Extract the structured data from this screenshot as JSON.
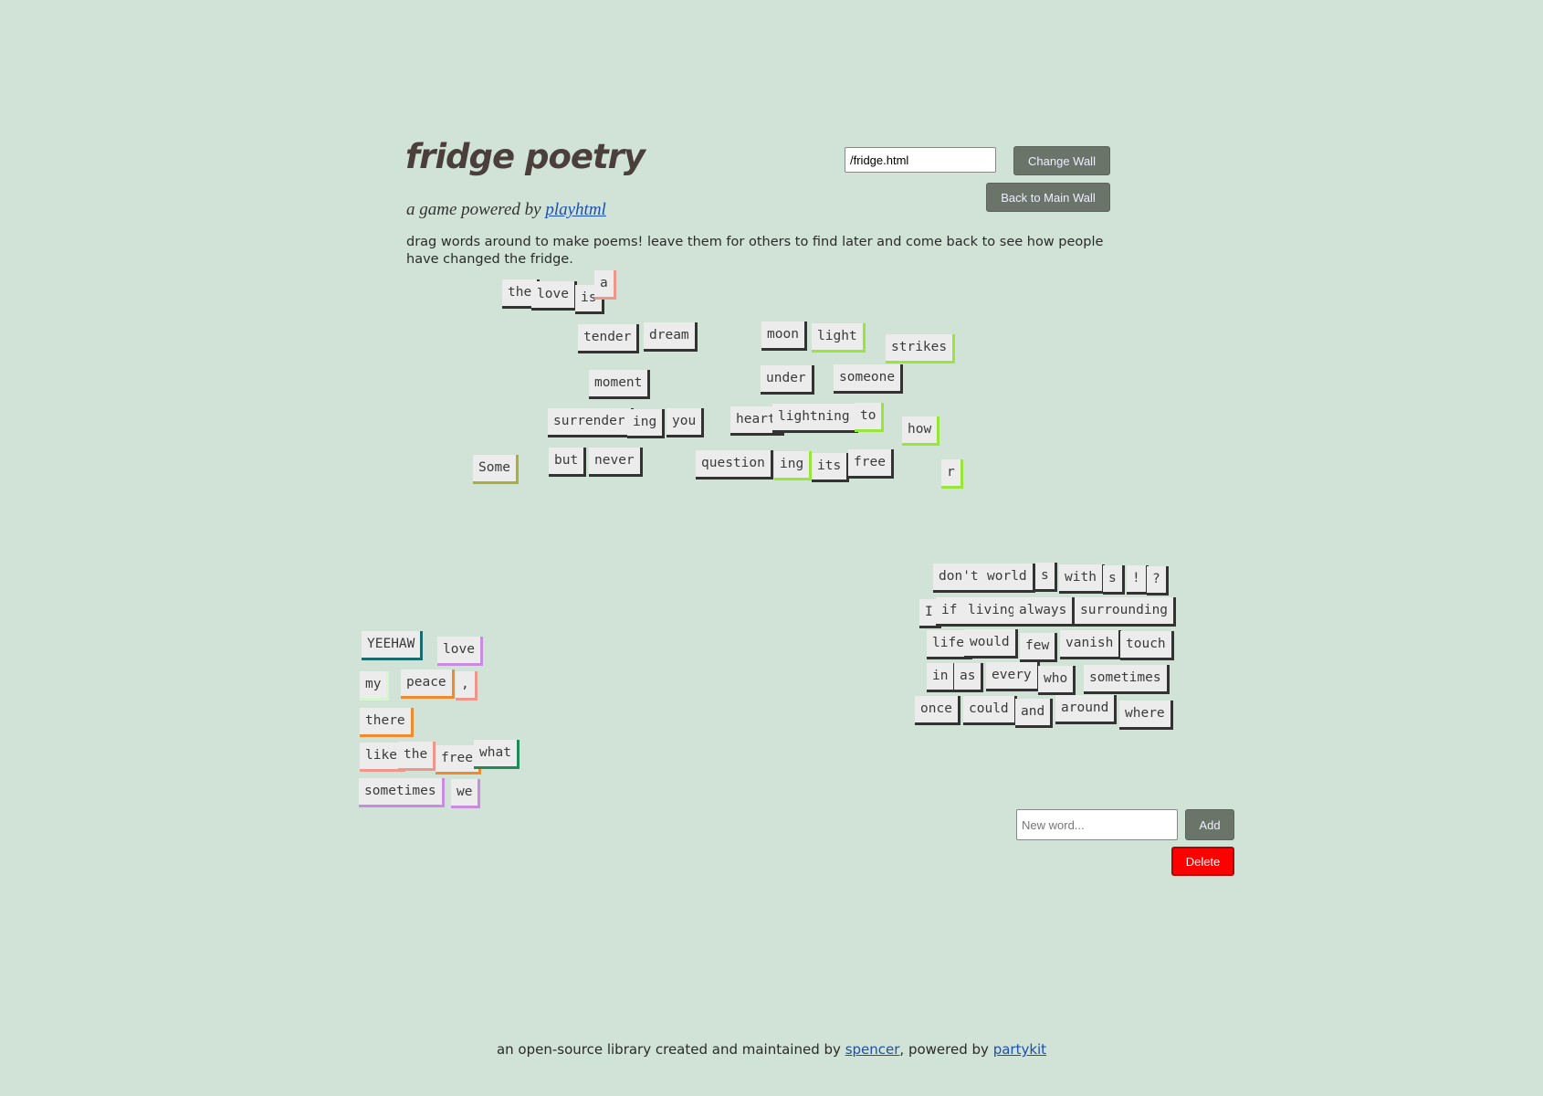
{
  "header": {
    "title": "fridge poetry",
    "subtitle_prefix": "a game powered by",
    "subtitle_link": "playhtml",
    "description": "drag words around to make poems! leave them for others to find later and come back to see how people have changed the fridge."
  },
  "controls": {
    "wall_value": "/fridge.html",
    "change_wall_label": "Change Wall",
    "back_label": "Back to Main Wall",
    "new_word_placeholder": "New word...",
    "add_label": "Add",
    "delete_label": "Delete"
  },
  "footer": {
    "prefix": "an open-source library created and maintained by",
    "link1": "spencer",
    "middle": ", powered by",
    "link2": "partykit"
  },
  "colors": {
    "background": "#d1e3d6",
    "shadow_dark": "#333333",
    "green": "#99e63a",
    "salmon": "#f0958a",
    "orange": "#ef8a2e",
    "violet": "#c98be0",
    "teal": "#1a6b6e",
    "olive": "#a8b03a",
    "emerald": "#1f8a5a",
    "mint": "#d6f5d0",
    "delete": "#ff0000",
    "link": "#1a4fb5"
  },
  "words": [
    {
      "text": "the",
      "color": "dark"
    },
    {
      "text": "love",
      "color": "dark"
    },
    {
      "text": "is",
      "color": "dark"
    },
    {
      "text": "a",
      "color": "salmon"
    },
    {
      "text": "tender",
      "color": "dark"
    },
    {
      "text": "dream",
      "color": "dark"
    },
    {
      "text": "moon",
      "color": "dark"
    },
    {
      "text": "light",
      "color": "green"
    },
    {
      "text": "strikes",
      "color": "green"
    },
    {
      "text": "moment",
      "color": "dark"
    },
    {
      "text": "under",
      "color": "dark"
    },
    {
      "text": "someone",
      "color": "dark"
    },
    {
      "text": "surrender",
      "color": "dark"
    },
    {
      "text": "ing",
      "color": "dark"
    },
    {
      "text": "you",
      "color": "dark"
    },
    {
      "text": "heart",
      "color": "dark"
    },
    {
      "text": "lightning",
      "color": "dark"
    },
    {
      "text": "to",
      "color": "green"
    },
    {
      "text": "how",
      "color": "green"
    },
    {
      "text": "Some",
      "color": "olive"
    },
    {
      "text": "but",
      "color": "dark"
    },
    {
      "text": "never",
      "color": "dark"
    },
    {
      "text": "question",
      "color": "dark"
    },
    {
      "text": "ing",
      "color": "green"
    },
    {
      "text": "its",
      "color": "dark"
    },
    {
      "text": "free",
      "color": "dark"
    },
    {
      "text": "r",
      "color": "green"
    },
    {
      "text": "don't",
      "color": "dark"
    },
    {
      "text": "world",
      "color": "dark"
    },
    {
      "text": "s",
      "color": "dark"
    },
    {
      "text": "with",
      "color": "dark"
    },
    {
      "text": "s",
      "color": "dark"
    },
    {
      "text": "!",
      "color": "dark"
    },
    {
      "text": "?",
      "color": "dark"
    },
    {
      "text": "I",
      "color": "dark"
    },
    {
      "text": "if",
      "color": "dark"
    },
    {
      "text": "living",
      "color": "dark"
    },
    {
      "text": "always",
      "color": "dark"
    },
    {
      "text": "surrounding",
      "color": "dark"
    },
    {
      "text": "life",
      "color": "dark"
    },
    {
      "text": "would",
      "color": "dark"
    },
    {
      "text": "few",
      "color": "dark"
    },
    {
      "text": "vanish",
      "color": "dark"
    },
    {
      "text": "touch",
      "color": "dark"
    },
    {
      "text": "in",
      "color": "dark"
    },
    {
      "text": "as",
      "color": "dark"
    },
    {
      "text": "every",
      "color": "dark"
    },
    {
      "text": "who",
      "color": "dark"
    },
    {
      "text": "sometimes",
      "color": "dark"
    },
    {
      "text": "once",
      "color": "dark"
    },
    {
      "text": "could",
      "color": "dark"
    },
    {
      "text": "and",
      "color": "dark"
    },
    {
      "text": "around",
      "color": "dark"
    },
    {
      "text": "where",
      "color": "dark"
    },
    {
      "text": "YEEHAW",
      "color": "teal"
    },
    {
      "text": "love",
      "color": "violet"
    },
    {
      "text": "my",
      "color": "mint"
    },
    {
      "text": "peace",
      "color": "orange"
    },
    {
      "text": ",",
      "color": "salmon"
    },
    {
      "text": "there",
      "color": "orange"
    },
    {
      "text": "like",
      "color": "salmon"
    },
    {
      "text": "the",
      "color": "salmon"
    },
    {
      "text": "free",
      "color": "orange"
    },
    {
      "text": "what",
      "color": "emerald"
    },
    {
      "text": "sometimes",
      "color": "violet"
    },
    {
      "text": "we",
      "color": "violet"
    }
  ]
}
